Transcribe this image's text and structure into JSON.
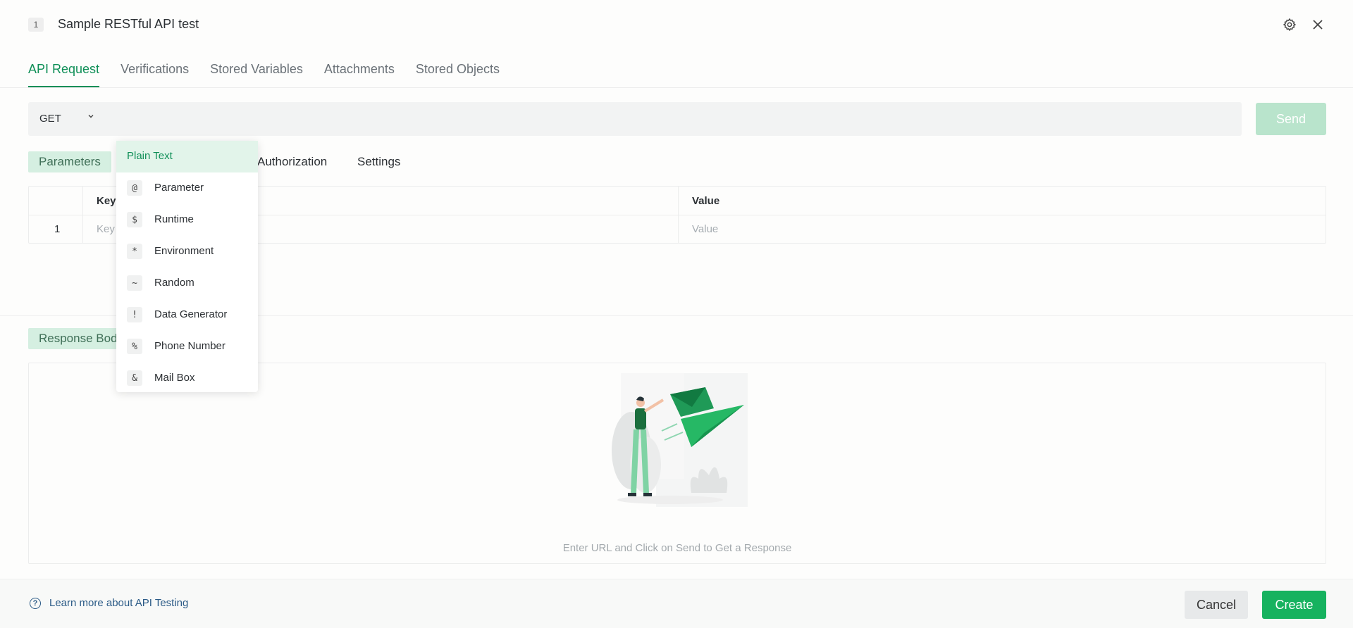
{
  "header": {
    "step_number": "1",
    "title": "Sample RESTful API test",
    "settings_icon": "gear-icon",
    "close_icon": "close-icon"
  },
  "tabs": [
    {
      "label": "API Request",
      "active": true
    },
    {
      "label": "Verifications"
    },
    {
      "label": "Stored Variables"
    },
    {
      "label": "Attachments"
    },
    {
      "label": "Stored Objects"
    }
  ],
  "request": {
    "method": "GET",
    "url_value": "",
    "send_label": "Send"
  },
  "subtabs": [
    {
      "label": "Parameters",
      "active": true
    },
    {
      "label": "Authorization"
    },
    {
      "label": "Settings"
    }
  ],
  "params_table": {
    "headers": {
      "key": "Key",
      "value": "Value"
    },
    "rows": [
      {
        "num": "1",
        "key_placeholder": "Key",
        "value_placeholder": "Value"
      }
    ]
  },
  "response": {
    "tab_label": "Response Body",
    "hint": "Enter URL and Click on Send to Get a Response"
  },
  "value_type_menu": {
    "items": [
      {
        "symbol": "",
        "label": "Plain Text",
        "selected": true
      },
      {
        "symbol": "@",
        "label": "Parameter"
      },
      {
        "symbol": "$",
        "label": "Runtime"
      },
      {
        "symbol": "*",
        "label": "Environment"
      },
      {
        "symbol": "~",
        "label": "Random"
      },
      {
        "symbol": "!",
        "label": "Data Generator"
      },
      {
        "symbol": "%",
        "label": "Phone Number"
      },
      {
        "symbol": "&",
        "label": "Mail Box"
      }
    ]
  },
  "footer": {
    "help_link": "Learn more about API Testing",
    "help_icon": "question-circle-icon",
    "cancel_label": "Cancel",
    "create_label": "Create"
  },
  "colors": {
    "accent": "#0f8f57",
    "primary_button": "#16b25f",
    "disabled_button": "#b9e4cc",
    "active_subtab_bg": "#d5efe1",
    "link": "#2a5a86"
  }
}
